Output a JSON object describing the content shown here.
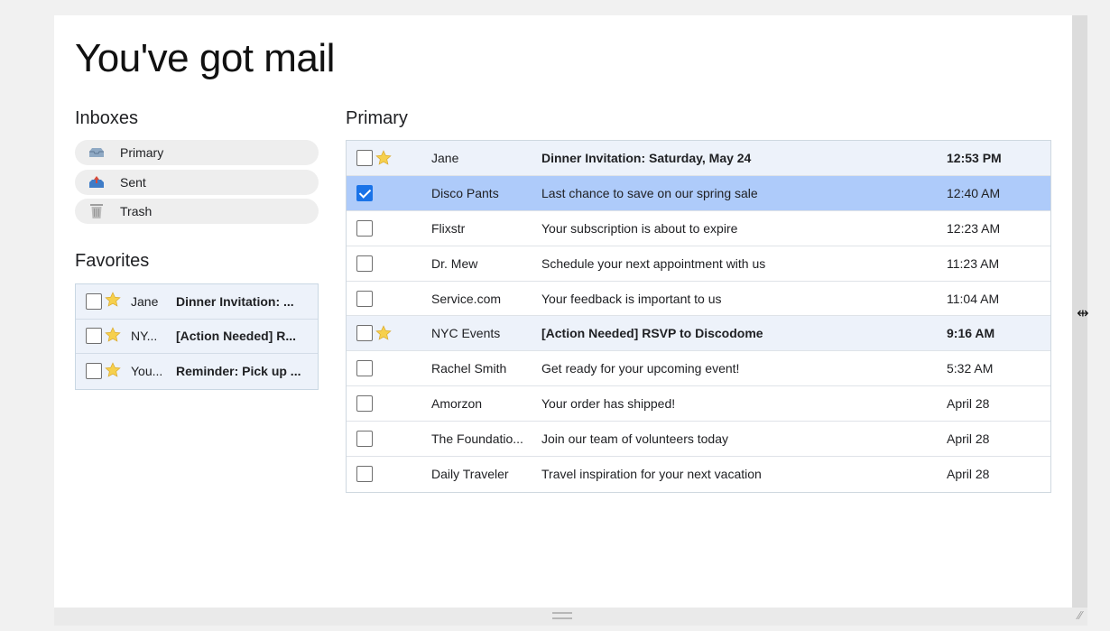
{
  "page": {
    "title": "You've got mail"
  },
  "sidebar": {
    "inboxes_heading": "Inboxes",
    "inboxes": [
      {
        "label": "Primary",
        "icon": "inbox-tray-icon"
      },
      {
        "label": "Sent",
        "icon": "outbox-tray-icon"
      },
      {
        "label": "Trash",
        "icon": "trash-can-icon"
      }
    ],
    "favorites_heading": "Favorites",
    "favorites": [
      {
        "sender": "Jane",
        "subject": "Dinner Invitation: ..."
      },
      {
        "sender": "NY...",
        "subject": "[Action Needed] R..."
      },
      {
        "sender": "You...",
        "subject": "Reminder: Pick up ..."
      }
    ]
  },
  "main": {
    "heading": "Primary",
    "rows": [
      {
        "sender": "Jane",
        "subject": "Dinner Invitation: Saturday, May 24",
        "time": "12:53 PM",
        "starred": true,
        "checked": false,
        "bold": true
      },
      {
        "sender": "Disco Pants",
        "subject": "Last chance to save on our spring sale",
        "time": "12:40 AM",
        "starred": false,
        "checked": true,
        "bold": false
      },
      {
        "sender": "Flixstr",
        "subject": "Your subscription is about to expire",
        "time": "12:23 AM",
        "starred": false,
        "checked": false,
        "bold": false
      },
      {
        "sender": "Dr. Mew",
        "subject": "Schedule your next appointment with us",
        "time": "11:23 AM",
        "starred": false,
        "checked": false,
        "bold": false
      },
      {
        "sender": "Service.com",
        "subject": "Your feedback is important to us",
        "time": "11:04 AM",
        "starred": false,
        "checked": false,
        "bold": false
      },
      {
        "sender": "NYC Events",
        "subject": "[Action Needed] RSVP to Discodome",
        "time": "9:16 AM",
        "starred": true,
        "checked": false,
        "bold": true
      },
      {
        "sender": "Rachel Smith",
        "subject": "Get ready for your upcoming event!",
        "time": "5:32 AM",
        "starred": false,
        "checked": false,
        "bold": false
      },
      {
        "sender": "Amorzon",
        "subject": "Your order has shipped!",
        "time": "April 28",
        "starred": false,
        "checked": false,
        "bold": false
      },
      {
        "sender": "The Foundatio...",
        "subject": "Join our team of volunteers today",
        "time": "April 28",
        "starred": false,
        "checked": false,
        "bold": false
      },
      {
        "sender": "Daily Traveler",
        "subject": "Travel inspiration for your next vacation",
        "time": "April 28",
        "starred": false,
        "checked": false,
        "bold": false
      }
    ]
  },
  "colors": {
    "selected_row": "#aecbfa",
    "starred_row": "#edf2fa",
    "checkbox_checked": "#1a73e8",
    "star": "#f6d04d"
  }
}
